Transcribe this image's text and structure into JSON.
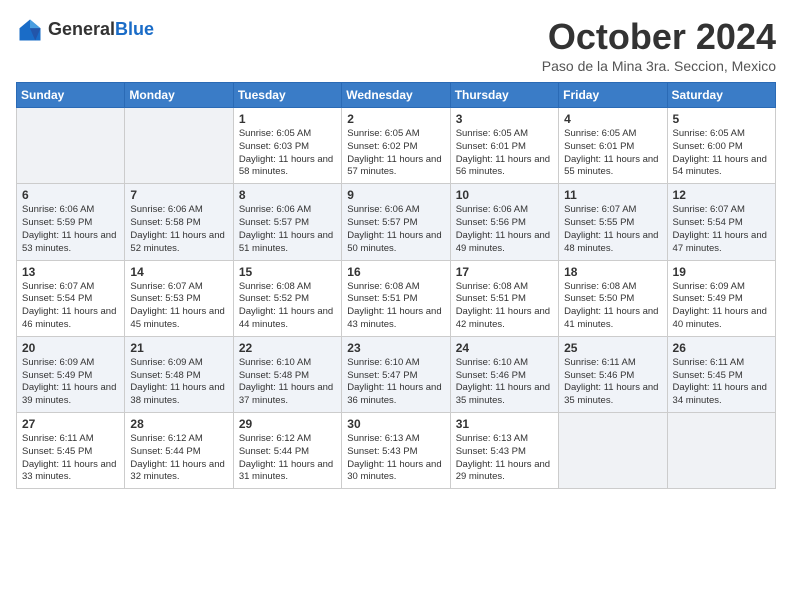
{
  "logo": {
    "general": "General",
    "blue": "Blue"
  },
  "header": {
    "month": "October 2024",
    "location": "Paso de la Mina 3ra. Seccion, Mexico"
  },
  "weekdays": [
    "Sunday",
    "Monday",
    "Tuesday",
    "Wednesday",
    "Thursday",
    "Friday",
    "Saturday"
  ],
  "weeks": [
    [
      {
        "day": "",
        "info": ""
      },
      {
        "day": "",
        "info": ""
      },
      {
        "day": "1",
        "info": "Sunrise: 6:05 AM\nSunset: 6:03 PM\nDaylight: 11 hours and 58 minutes."
      },
      {
        "day": "2",
        "info": "Sunrise: 6:05 AM\nSunset: 6:02 PM\nDaylight: 11 hours and 57 minutes."
      },
      {
        "day": "3",
        "info": "Sunrise: 6:05 AM\nSunset: 6:01 PM\nDaylight: 11 hours and 56 minutes."
      },
      {
        "day": "4",
        "info": "Sunrise: 6:05 AM\nSunset: 6:01 PM\nDaylight: 11 hours and 55 minutes."
      },
      {
        "day": "5",
        "info": "Sunrise: 6:05 AM\nSunset: 6:00 PM\nDaylight: 11 hours and 54 minutes."
      }
    ],
    [
      {
        "day": "6",
        "info": "Sunrise: 6:06 AM\nSunset: 5:59 PM\nDaylight: 11 hours and 53 minutes."
      },
      {
        "day": "7",
        "info": "Sunrise: 6:06 AM\nSunset: 5:58 PM\nDaylight: 11 hours and 52 minutes."
      },
      {
        "day": "8",
        "info": "Sunrise: 6:06 AM\nSunset: 5:57 PM\nDaylight: 11 hours and 51 minutes."
      },
      {
        "day": "9",
        "info": "Sunrise: 6:06 AM\nSunset: 5:57 PM\nDaylight: 11 hours and 50 minutes."
      },
      {
        "day": "10",
        "info": "Sunrise: 6:06 AM\nSunset: 5:56 PM\nDaylight: 11 hours and 49 minutes."
      },
      {
        "day": "11",
        "info": "Sunrise: 6:07 AM\nSunset: 5:55 PM\nDaylight: 11 hours and 48 minutes."
      },
      {
        "day": "12",
        "info": "Sunrise: 6:07 AM\nSunset: 5:54 PM\nDaylight: 11 hours and 47 minutes."
      }
    ],
    [
      {
        "day": "13",
        "info": "Sunrise: 6:07 AM\nSunset: 5:54 PM\nDaylight: 11 hours and 46 minutes."
      },
      {
        "day": "14",
        "info": "Sunrise: 6:07 AM\nSunset: 5:53 PM\nDaylight: 11 hours and 45 minutes."
      },
      {
        "day": "15",
        "info": "Sunrise: 6:08 AM\nSunset: 5:52 PM\nDaylight: 11 hours and 44 minutes."
      },
      {
        "day": "16",
        "info": "Sunrise: 6:08 AM\nSunset: 5:51 PM\nDaylight: 11 hours and 43 minutes."
      },
      {
        "day": "17",
        "info": "Sunrise: 6:08 AM\nSunset: 5:51 PM\nDaylight: 11 hours and 42 minutes."
      },
      {
        "day": "18",
        "info": "Sunrise: 6:08 AM\nSunset: 5:50 PM\nDaylight: 11 hours and 41 minutes."
      },
      {
        "day": "19",
        "info": "Sunrise: 6:09 AM\nSunset: 5:49 PM\nDaylight: 11 hours and 40 minutes."
      }
    ],
    [
      {
        "day": "20",
        "info": "Sunrise: 6:09 AM\nSunset: 5:49 PM\nDaylight: 11 hours and 39 minutes."
      },
      {
        "day": "21",
        "info": "Sunrise: 6:09 AM\nSunset: 5:48 PM\nDaylight: 11 hours and 38 minutes."
      },
      {
        "day": "22",
        "info": "Sunrise: 6:10 AM\nSunset: 5:48 PM\nDaylight: 11 hours and 37 minutes."
      },
      {
        "day": "23",
        "info": "Sunrise: 6:10 AM\nSunset: 5:47 PM\nDaylight: 11 hours and 36 minutes."
      },
      {
        "day": "24",
        "info": "Sunrise: 6:10 AM\nSunset: 5:46 PM\nDaylight: 11 hours and 35 minutes."
      },
      {
        "day": "25",
        "info": "Sunrise: 6:11 AM\nSunset: 5:46 PM\nDaylight: 11 hours and 35 minutes."
      },
      {
        "day": "26",
        "info": "Sunrise: 6:11 AM\nSunset: 5:45 PM\nDaylight: 11 hours and 34 minutes."
      }
    ],
    [
      {
        "day": "27",
        "info": "Sunrise: 6:11 AM\nSunset: 5:45 PM\nDaylight: 11 hours and 33 minutes."
      },
      {
        "day": "28",
        "info": "Sunrise: 6:12 AM\nSunset: 5:44 PM\nDaylight: 11 hours and 32 minutes."
      },
      {
        "day": "29",
        "info": "Sunrise: 6:12 AM\nSunset: 5:44 PM\nDaylight: 11 hours and 31 minutes."
      },
      {
        "day": "30",
        "info": "Sunrise: 6:13 AM\nSunset: 5:43 PM\nDaylight: 11 hours and 30 minutes."
      },
      {
        "day": "31",
        "info": "Sunrise: 6:13 AM\nSunset: 5:43 PM\nDaylight: 11 hours and 29 minutes."
      },
      {
        "day": "",
        "info": ""
      },
      {
        "day": "",
        "info": ""
      }
    ]
  ]
}
